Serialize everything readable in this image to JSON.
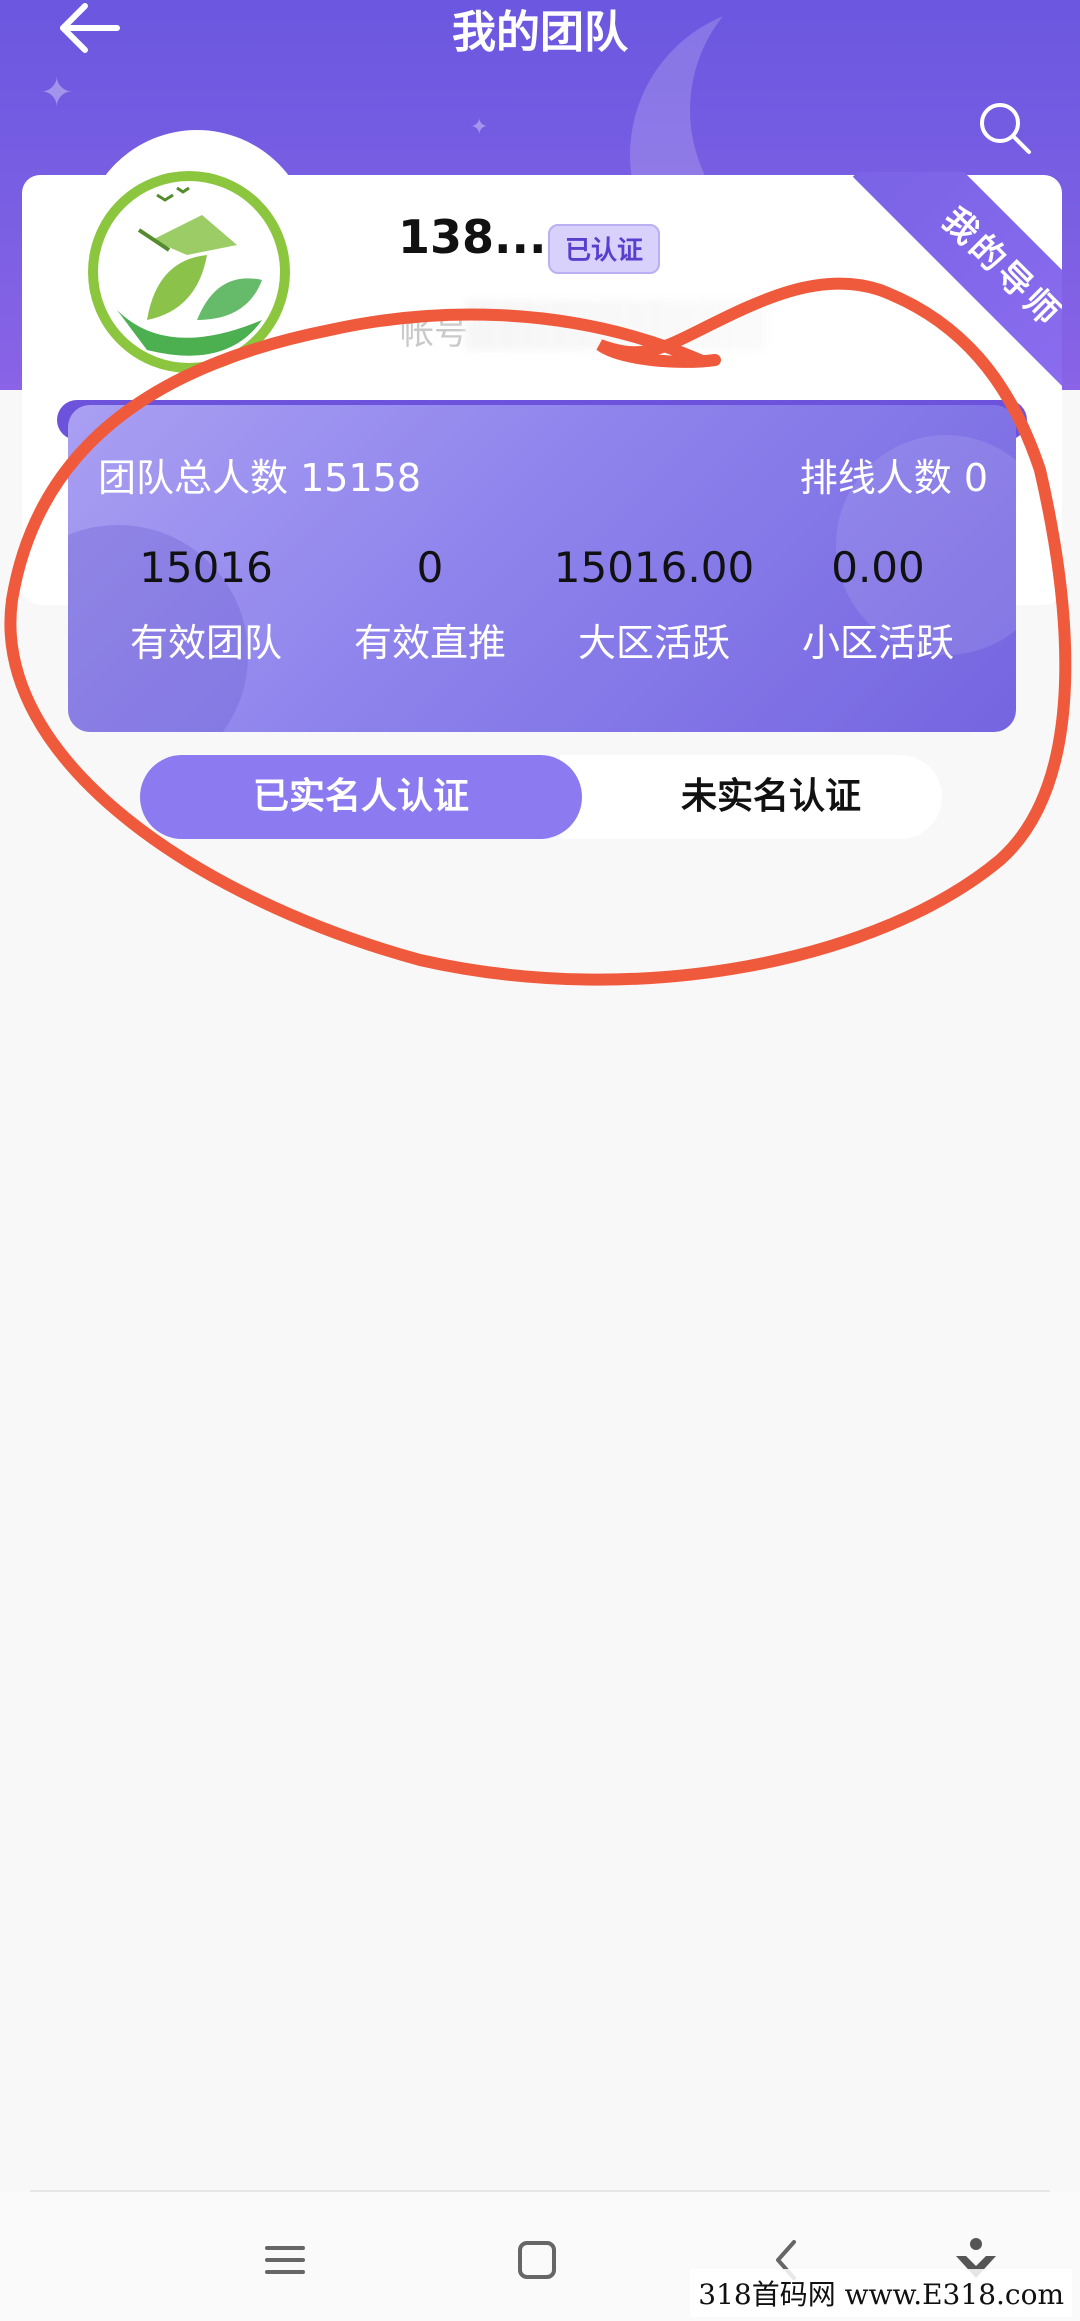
{
  "header": {
    "title": "我的团队",
    "back_icon": "arrow-left-icon",
    "search_icon": "search-icon"
  },
  "profile": {
    "username": "138...",
    "verified_badge": "已认证",
    "account_label": "帐号",
    "mentor_ribbon": "我的导师",
    "avatar_icon": "leaf-logo-icon"
  },
  "stats": {
    "team_total_label": "团队总人数",
    "team_total_value": "15158",
    "lineup_label": "排线人数",
    "lineup_value": "0",
    "items": [
      {
        "value": "15016",
        "label": "有效团队"
      },
      {
        "value": "0",
        "label": "有效直推"
      },
      {
        "value": "15016.00",
        "label": "大区活跃"
      },
      {
        "value": "0.00",
        "label": "小区活跃"
      }
    ]
  },
  "tabs": {
    "verified": "已实名人认证",
    "unverified": "未实名认证"
  },
  "navbar": {
    "icons": [
      "menu-icon",
      "home-icon",
      "back-icon",
      "assistant-icon"
    ]
  },
  "watermark": "318首码网  www.E318.com",
  "colors": {
    "header": "#6b57e0",
    "accent": "#8b7af0",
    "annotation": "#f05a3c"
  }
}
